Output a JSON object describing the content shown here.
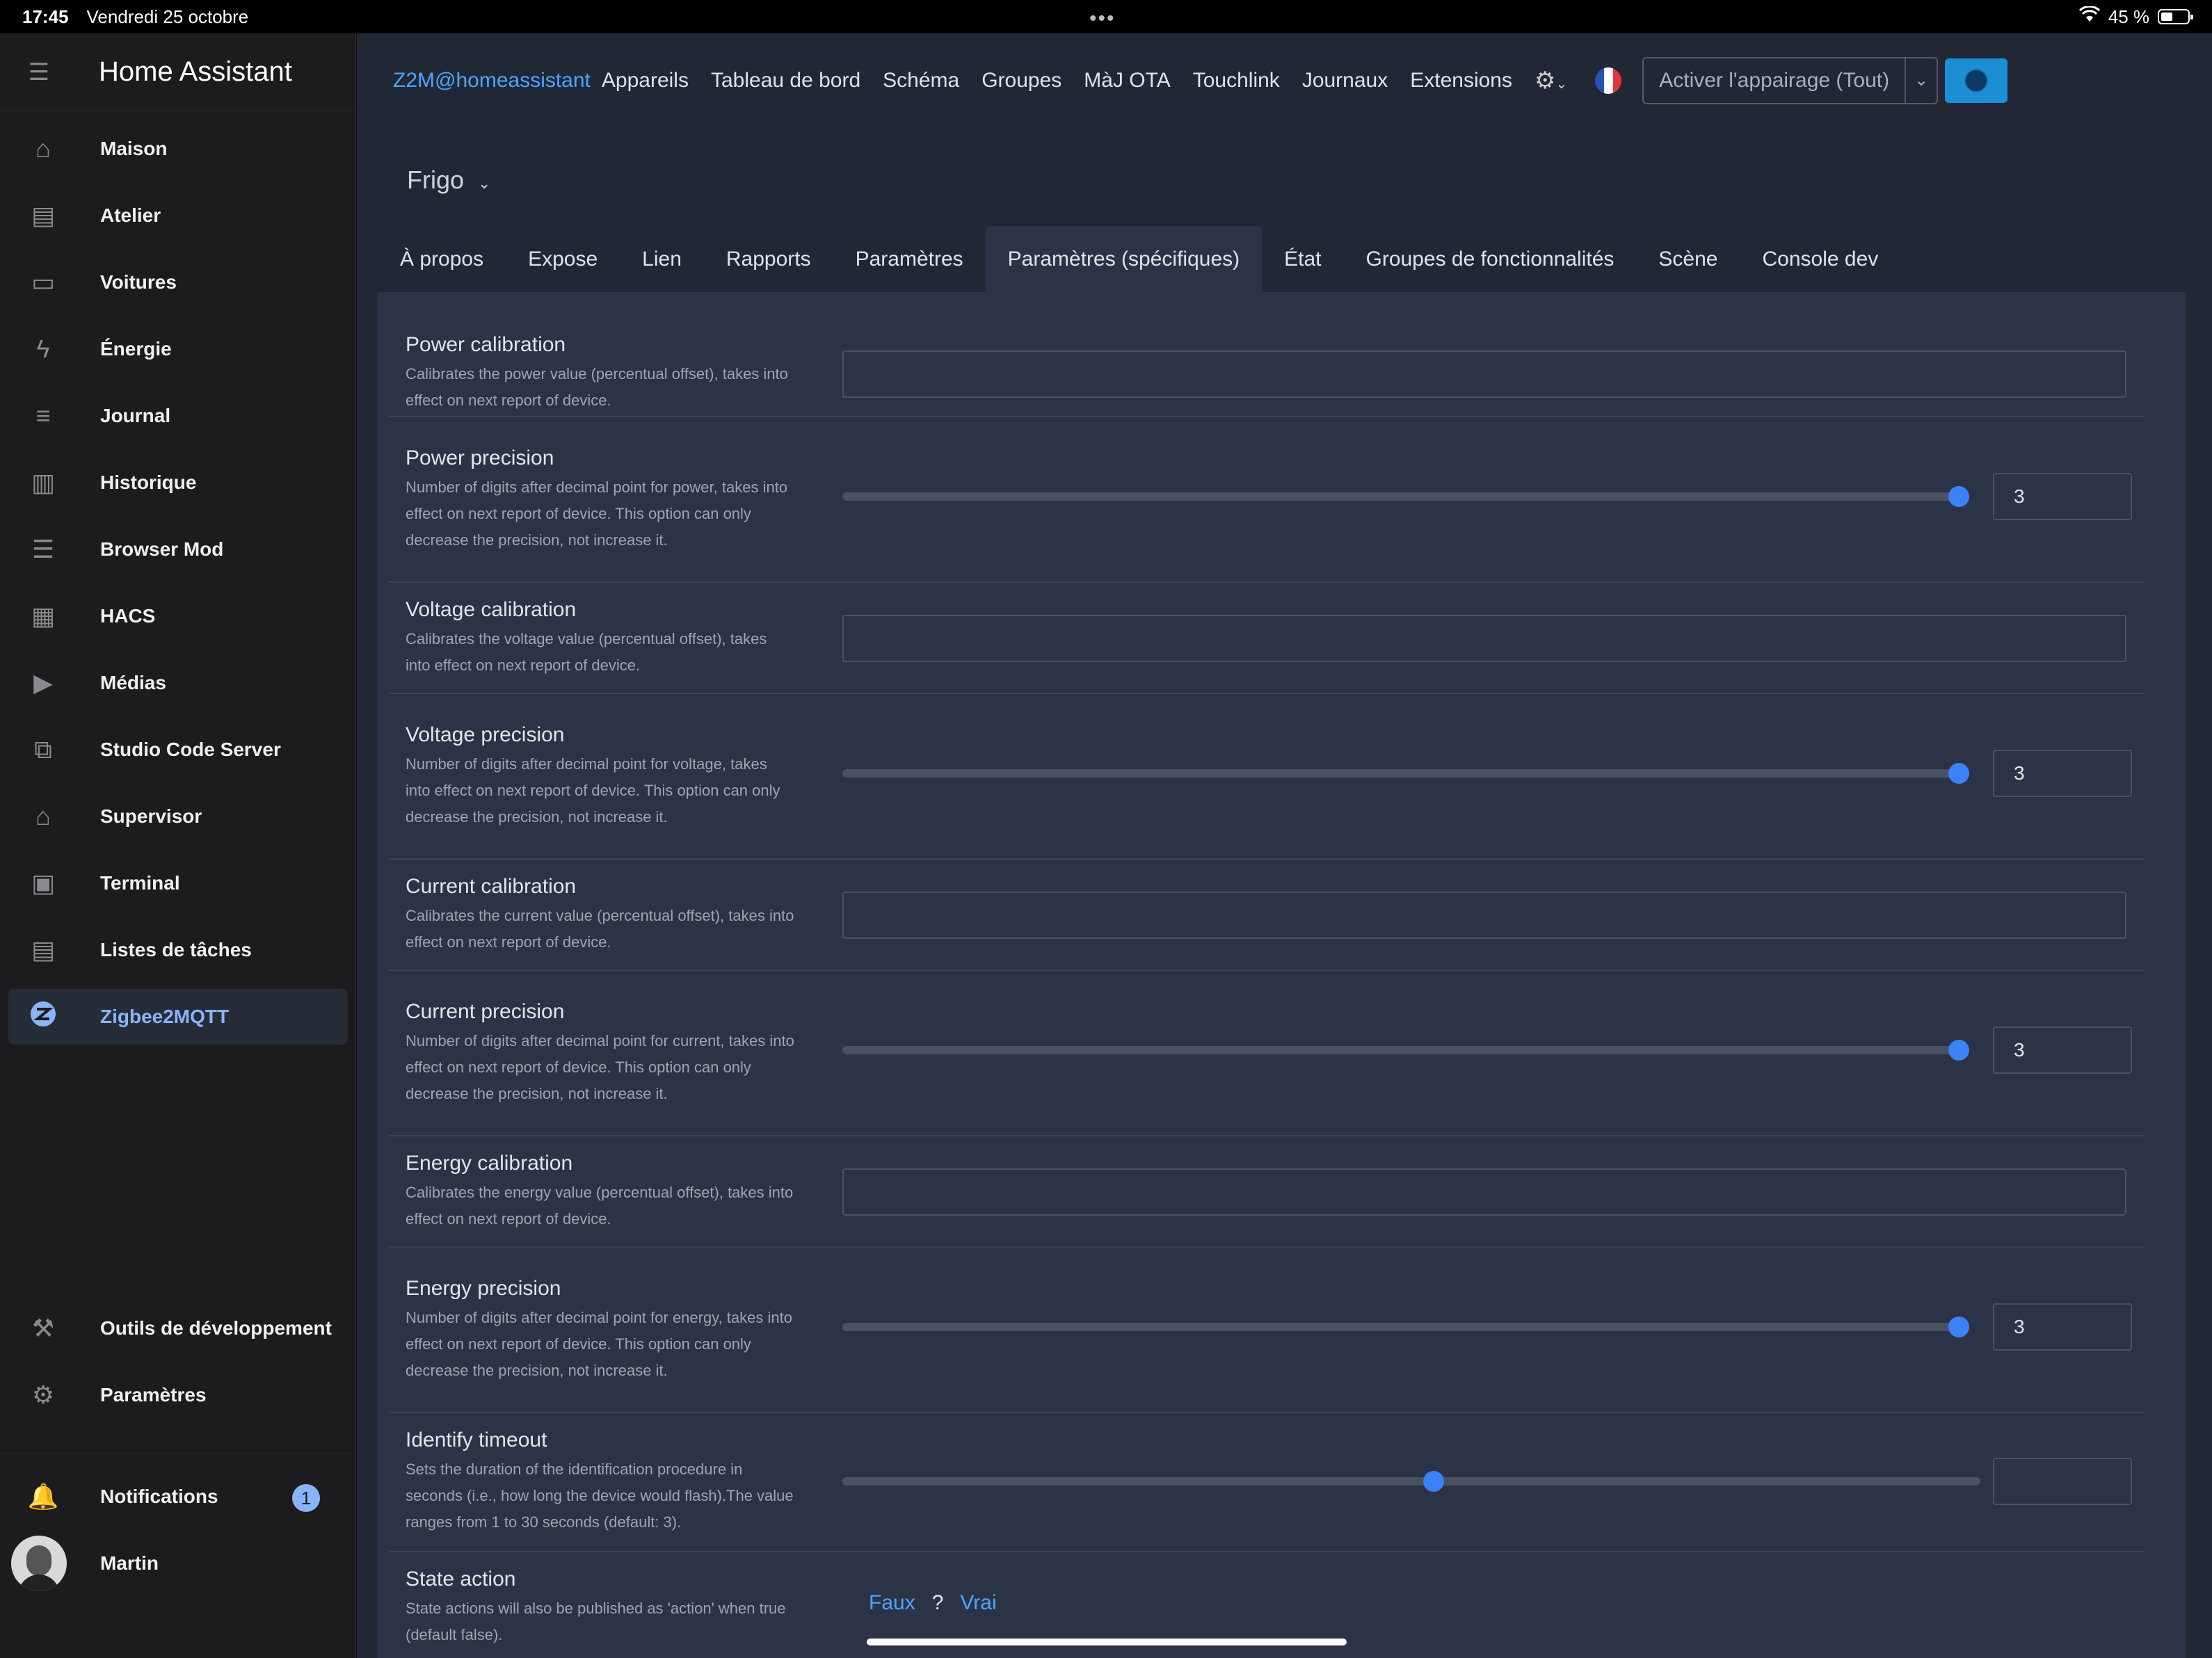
{
  "status_bar": {
    "time": "17:45",
    "date": "Vendredi 25 octobre",
    "battery": "45 %",
    "battery_level": 0.45
  },
  "sidebar": {
    "title": "Home Assistant",
    "items": [
      {
        "label": "Maison",
        "icon": "home-icon"
      },
      {
        "label": "Atelier",
        "icon": "workshop-icon"
      },
      {
        "label": "Voitures",
        "icon": "car-icon"
      },
      {
        "label": "Énergie",
        "icon": "lightning-icon"
      },
      {
        "label": "Journal",
        "icon": "list-icon"
      },
      {
        "label": "Historique",
        "icon": "chart-icon"
      },
      {
        "label": "Browser Mod",
        "icon": "server-icon"
      },
      {
        "label": "HACS",
        "icon": "hacs-icon"
      },
      {
        "label": "Médias",
        "icon": "media-icon"
      },
      {
        "label": "Studio Code Server",
        "icon": "vscode-icon"
      },
      {
        "label": "Supervisor",
        "icon": "supervisor-icon"
      },
      {
        "label": "Terminal",
        "icon": "terminal-icon"
      },
      {
        "label": "Listes de tâches",
        "icon": "clipboard-icon"
      },
      {
        "label": "Zigbee2MQTT",
        "icon": "zigbee-icon",
        "active": true
      }
    ],
    "bottom_items": [
      {
        "label": "Outils de développement",
        "icon": "hammer-icon"
      },
      {
        "label": "Paramètres",
        "icon": "gear-icon"
      }
    ],
    "notifications": {
      "label": "Notifications",
      "count": "1"
    },
    "user": {
      "name": "Martin"
    }
  },
  "topnav": {
    "brand": "Z2M@homeassistant",
    "links": [
      "Appareils",
      "Tableau de bord",
      "Schéma",
      "Groupes",
      "MàJ OTA",
      "Touchlink",
      "Journaux",
      "Extensions"
    ],
    "pair_button": "Activer l'appairage (Tout)",
    "accent": "#4aa6ff"
  },
  "device": {
    "name": "Frigo"
  },
  "tabs": [
    "À propos",
    "Expose",
    "Lien",
    "Rapports",
    "Paramètres",
    "Paramètres (spécifiques)",
    "État",
    "Groupes de fonctionnalités",
    "Scène",
    "Console dev"
  ],
  "active_tab": "Paramètres (spécifiques)",
  "settings": [
    {
      "title": "Power calibration",
      "desc": "Calibrates the power value (percentual offset), takes into effect on next report of device.",
      "type": "text",
      "value": ""
    },
    {
      "title": "Power precision",
      "desc": "Number of digits after decimal point for power, takes into effect on next report of device. This option can only decrease the precision, not increase it.",
      "type": "slider",
      "value": "3",
      "level": 1.0
    },
    {
      "title": "Voltage calibration",
      "desc": "Calibrates the voltage value (percentual offset), takes into effect on next report of device.",
      "type": "text",
      "value": ""
    },
    {
      "title": "Voltage precision",
      "desc": "Number of digits after decimal point for voltage, takes into effect on next report of device. This option can only decrease the precision, not increase it.",
      "type": "slider",
      "value": "3",
      "level": 1.0
    },
    {
      "title": "Current calibration",
      "desc": "Calibrates the current value (percentual offset), takes into effect on next report of device.",
      "type": "text",
      "value": ""
    },
    {
      "title": "Current precision",
      "desc": "Number of digits after decimal point for current, takes into effect on next report of device. This option can only decrease the precision, not increase it.",
      "type": "slider",
      "value": "3",
      "level": 1.0
    },
    {
      "title": "Energy calibration",
      "desc": "Calibrates the energy value (percentual offset), takes into effect on next report of device.",
      "type": "text",
      "value": ""
    },
    {
      "title": "Energy precision",
      "desc": "Number of digits after decimal point for energy, takes into effect on next report of device. This option can only decrease the precision, not increase it.",
      "type": "slider",
      "value": "3",
      "level": 1.0
    },
    {
      "title": "Identify timeout",
      "desc": "Sets the duration of the identification procedure in seconds (i.e., how long the device would flash).The value ranges from 1 to 30 seconds (default: 3).",
      "type": "slider",
      "value": "",
      "level": 0.52
    },
    {
      "title": "State action",
      "desc": "State actions will also be published as 'action' when true (default false).",
      "type": "toggle",
      "false_label": "Faux",
      "unknown_label": "?",
      "true_label": "Vrai"
    }
  ]
}
